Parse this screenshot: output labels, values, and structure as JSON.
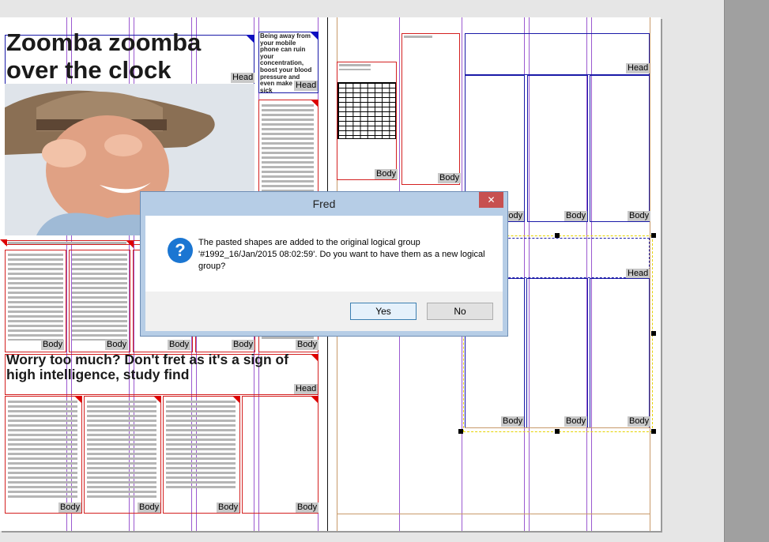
{
  "page": {
    "headline_1": "Zoomba zoomba over the clock",
    "sidebar_snippet": "Being away from your mobile phone can ruin your concentration, boost your blood pressure and even make feel sick",
    "headline_2": "Worry too much? Don't fret as it's a sign of high intelligence, study find",
    "tag_head": "Head",
    "tag_body": "Body"
  },
  "dialog": {
    "title": "Fred",
    "close_glyph": "✕",
    "icon_glyph": "?",
    "message": "The pasted shapes are added to the original logical group '#1992_16/Jan/2015 08:02:59'. Do you want to have them as a new logical group?",
    "yes_label": "Yes",
    "no_label": "No"
  },
  "colors": {
    "frame_red": "#d42020",
    "frame_blue": "#1a1aa8",
    "guide_purple": "#9b59d0",
    "dialog_blue": "#b6cde6",
    "info_icon": "#1b76d2"
  }
}
